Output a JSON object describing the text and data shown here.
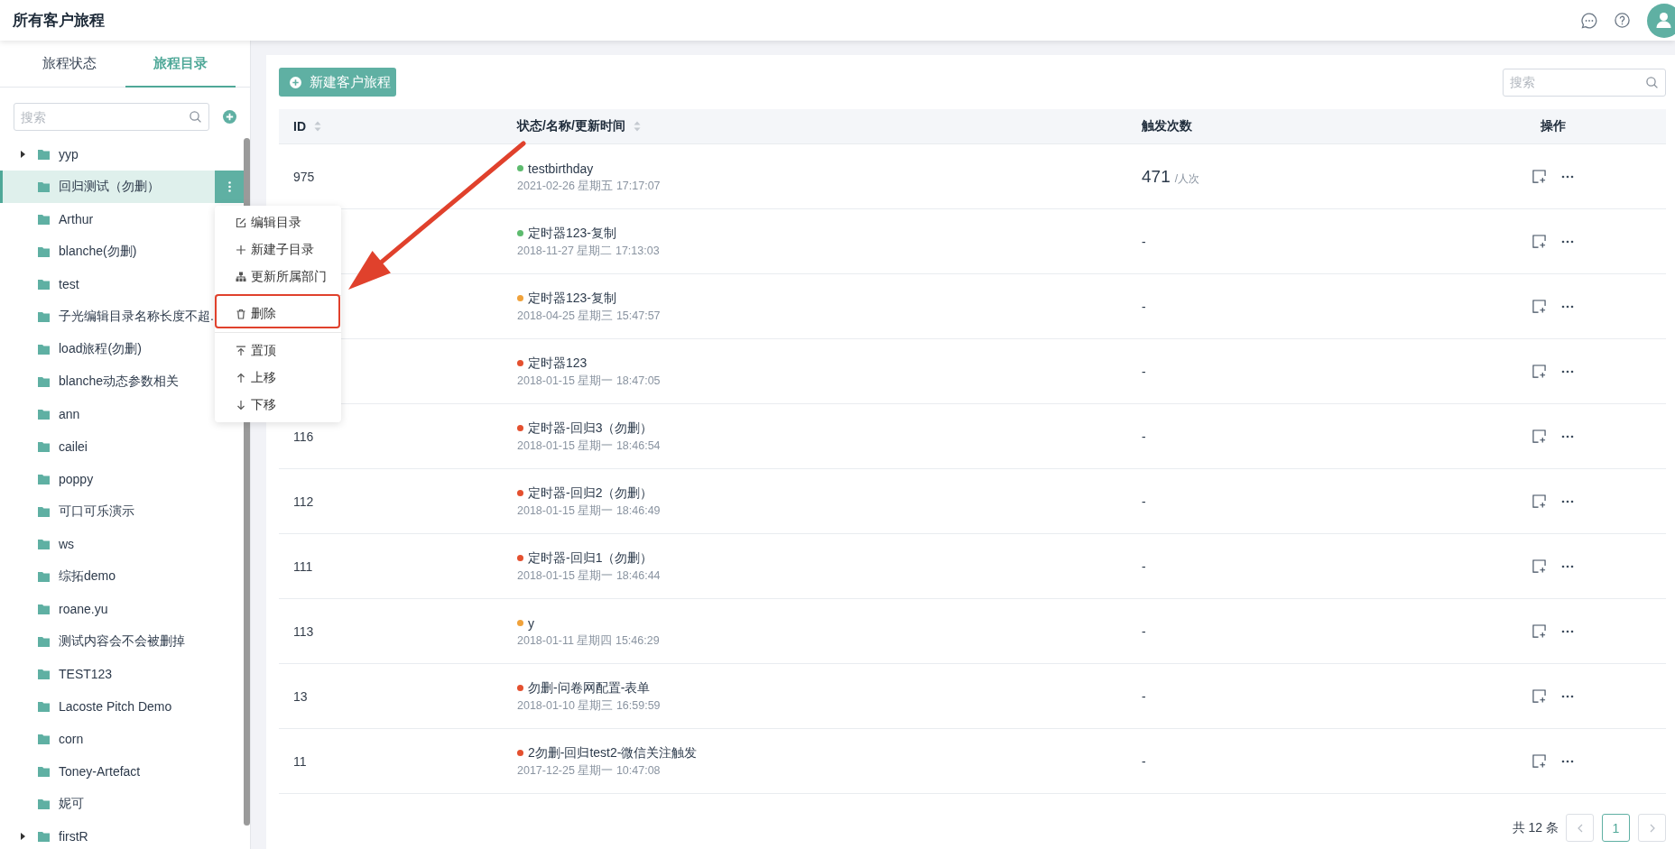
{
  "header": {
    "title": "所有客户旅程"
  },
  "sidebar": {
    "tabs": [
      {
        "label": "旅程状态",
        "selected": false
      },
      {
        "label": "旅程目录",
        "selected": true
      }
    ],
    "search": {
      "placeholder": "搜索"
    },
    "tree": [
      {
        "label": "yyp",
        "expandable": true,
        "selected": false
      },
      {
        "label": "回归测试（勿删）",
        "expandable": false,
        "selected": true
      },
      {
        "label": "Arthur",
        "expandable": false,
        "selected": false
      },
      {
        "label": "blanche(勿删)",
        "expandable": false,
        "selected": false
      },
      {
        "label": "test",
        "expandable": false,
        "selected": false
      },
      {
        "label": "子光编辑目录名称长度不超.",
        "expandable": false,
        "selected": false
      },
      {
        "label": "load旅程(勿删)",
        "expandable": false,
        "selected": false
      },
      {
        "label": "blanche动态参数相关",
        "expandable": false,
        "selected": false
      },
      {
        "label": "ann",
        "expandable": false,
        "selected": false
      },
      {
        "label": "cailei",
        "expandable": false,
        "selected": false
      },
      {
        "label": "poppy",
        "expandable": false,
        "selected": false
      },
      {
        "label": "可口可乐演示",
        "expandable": false,
        "selected": false
      },
      {
        "label": "ws",
        "expandable": false,
        "selected": false
      },
      {
        "label": "综拓demo",
        "expandable": false,
        "selected": false
      },
      {
        "label": "roane.yu",
        "expandable": false,
        "selected": false
      },
      {
        "label": "测试内容会不会被删掉",
        "expandable": false,
        "selected": false
      },
      {
        "label": "TEST123",
        "expandable": false,
        "selected": false
      },
      {
        "label": "Lacoste Pitch Demo",
        "expandable": false,
        "selected": false
      },
      {
        "label": "corn",
        "expandable": false,
        "selected": false
      },
      {
        "label": "Toney-Artefact",
        "expandable": false,
        "selected": false
      },
      {
        "label": "妮可",
        "expandable": false,
        "selected": false
      },
      {
        "label": "firstR",
        "expandable": true,
        "selected": false
      }
    ]
  },
  "context_menu": {
    "groups": [
      [
        {
          "label": "编辑目录",
          "highlighted": false
        },
        {
          "label": "新建子目录",
          "highlighted": false
        },
        {
          "label": "更新所属部门",
          "highlighted": false
        }
      ],
      [
        {
          "label": "删除",
          "highlighted": true
        }
      ],
      [
        {
          "label": "置顶",
          "highlighted": false
        },
        {
          "label": "上移",
          "highlighted": false
        },
        {
          "label": "下移",
          "highlighted": false
        }
      ]
    ]
  },
  "toolbar": {
    "new_button": "新建客户旅程",
    "search": {
      "placeholder": "搜索"
    }
  },
  "table": {
    "columns": [
      {
        "label": "ID",
        "sortable": true
      },
      {
        "label": "状态/名称/更新时间",
        "sortable": true
      },
      {
        "label": "触发次数",
        "sortable": false
      },
      {
        "label": "操作",
        "sortable": false
      }
    ],
    "rows": [
      {
        "id": "975",
        "name": "testbirthday",
        "color": "#5dbb6e",
        "updated": "2021-02-26 星期五 17:17:07",
        "triggers": "471",
        "trigger_unit": "/人次"
      },
      {
        "name": "定时器123-复制",
        "color": "#5dbb6e",
        "updated": "2018-11-27 星期二 17:13:03",
        "triggers": "-"
      },
      {
        "name": "定时器123-复制",
        "color": "#f0a23b",
        "updated": "2018-04-25 星期三 15:47:57",
        "triggers": "-"
      },
      {
        "name": "定时器123",
        "color": "#e4502f",
        "updated": "2018-01-15 星期一 18:47:05",
        "triggers": "-"
      },
      {
        "id": "116",
        "name": "定时器-回归3（勿删）",
        "color": "#e4502f",
        "updated": "2018-01-15 星期一 18:46:54",
        "triggers": "-"
      },
      {
        "id": "112",
        "name": "定时器-回归2（勿删）",
        "color": "#e4502f",
        "updated": "2018-01-15 星期一 18:46:49",
        "triggers": "-"
      },
      {
        "id": "111",
        "name": "定时器-回归1（勿删）",
        "color": "#e4502f",
        "updated": "2018-01-15 星期一 18:46:44",
        "triggers": "-"
      },
      {
        "id": "113",
        "name": "y",
        "color": "#f0a23b",
        "updated": "2018-01-11 星期四 15:46:29",
        "triggers": "-"
      },
      {
        "id": "13",
        "name": "勿删-问卷网配置-表单",
        "color": "#e4502f",
        "updated": "2018-01-10 星期三 16:59:59",
        "triggers": "-"
      },
      {
        "id": "11",
        "name": "2勿删-回归test2-微信关注触发",
        "color": "#e4502f",
        "updated": "2017-12-25 星期一 10:47:08",
        "triggers": "-"
      }
    ]
  },
  "pagination": {
    "total": "共 12 条",
    "pages": [
      {
        "label": "1",
        "selected": true
      }
    ]
  }
}
